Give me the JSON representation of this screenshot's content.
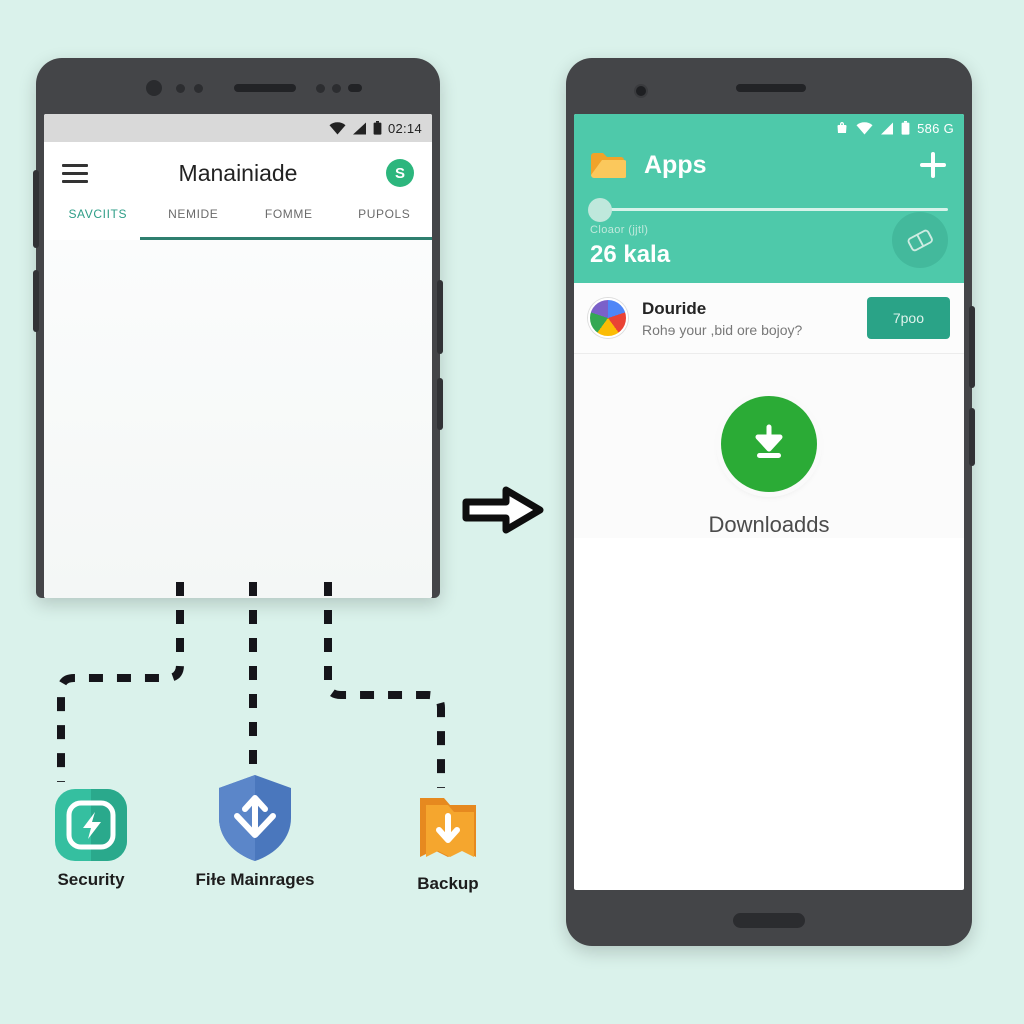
{
  "background_color": "#daf2eb",
  "left_phone": {
    "name": "android-phone-before",
    "status_bar": {
      "clock": "02:14",
      "icons": [
        "wifi-icon",
        "signal-icon",
        "battery-icon"
      ]
    },
    "app_bar": {
      "menu_icon": "hamburger-menu-icon",
      "title": "Manainiade",
      "avatar_letter": "S",
      "avatar_color": "#2cb67d"
    },
    "tabs": [
      {
        "label": "SAVCIITS",
        "active": true
      },
      {
        "label": "NEMIDE",
        "active": false
      },
      {
        "label": "FOMME",
        "active": false
      },
      {
        "label": "PUPOLS",
        "active": false
      }
    ],
    "tab_accent_color": "#2e9e87"
  },
  "right_phone": {
    "name": "android-phone-after",
    "status_bar": {
      "level": "586 G",
      "icons": [
        "app-alert-icon",
        "wifi-icon",
        "signal-icon",
        "battery-icon"
      ]
    },
    "header_color": "#4ec9aa",
    "app_bar": {
      "folder_icon": "folder-icon",
      "title": "Apps",
      "add_icon": "plus-icon"
    },
    "slider": {
      "value_percent": 0
    },
    "meta": {
      "caption": "Cloaor (jjtl)",
      "value": "26 kala",
      "fab_icon": "card-eraser-icon"
    },
    "promo": {
      "icon": "app-store-icon",
      "title": "Douride",
      "subtitle": "Rohɘ your ,bid ore bojoy?",
      "button_label": "7poo",
      "button_color": "#2aa387"
    },
    "download": {
      "icon": "download-arrow-icon",
      "icon_color": "#2bab36",
      "label": "Downloadds"
    }
  },
  "arrow": {
    "name": "flow-arrow-right",
    "direction": "right"
  },
  "features": [
    {
      "label": "Security",
      "icon": "security-shield-app-icon",
      "color": "#2eb396"
    },
    {
      "label": "Fiɫe Mainrages",
      "icon": "file-manager-shield-icon",
      "color": "#3f6fb5"
    },
    {
      "label": "Backup",
      "icon": "backup-folder-icon",
      "color": "#f0972a"
    }
  ]
}
